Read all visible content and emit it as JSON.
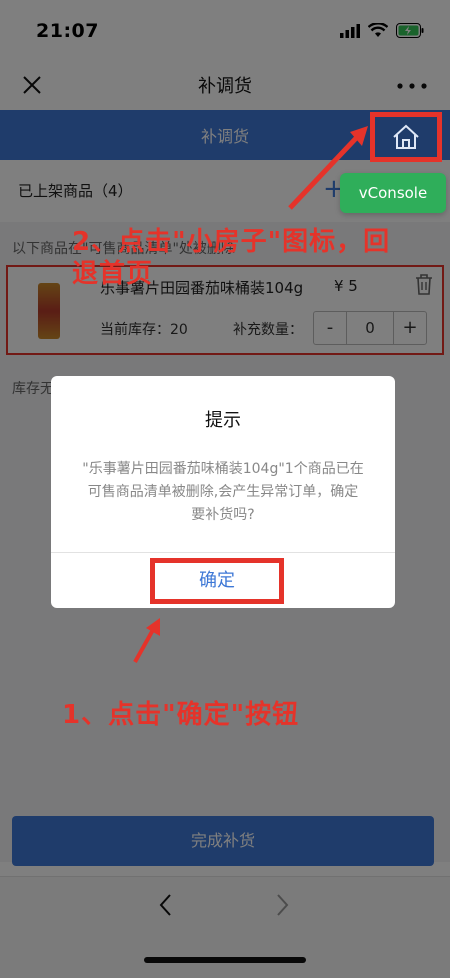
{
  "status_bar": {
    "time": "21:07"
  },
  "nav": {
    "title": "补调货"
  },
  "page": {
    "header_title": "补调货",
    "section_title": "已上架商品（4）",
    "section_add": "+",
    "vconsole_label": "vConsole",
    "notice": "以下商品在\"可售商品清单\"处被删除",
    "stock_notice": "库存无",
    "done_button": "完成补货"
  },
  "product": {
    "name": "乐事薯片田园番茄味桶装104g",
    "price": "¥ 5",
    "stock_label": "当前库存：20",
    "restock_label": "补充数量：",
    "minus": "-",
    "quantity": "0",
    "plus": "+"
  },
  "dialog": {
    "title": "提示",
    "message": "\"乐事薯片田园番茄味桶装104g\"1个商品已在可售商品清单被删除,会产生异常订单，确定要补货吗?",
    "confirm": "确定"
  },
  "annotations": {
    "step2": "2、点击\"小房子\"图标，回退首页",
    "step1": "1、点击\"确定\"按钮"
  },
  "colors": {
    "header_blue": "#3e78d6",
    "annotation_red": "#e5332a",
    "vconsole_green": "#2fae5a"
  },
  "icons": [
    "close-icon",
    "more-icon",
    "home-icon",
    "trash-icon",
    "back-arrow-icon",
    "forward-arrow-icon",
    "signal-icon",
    "wifi-icon",
    "battery-icon"
  ]
}
